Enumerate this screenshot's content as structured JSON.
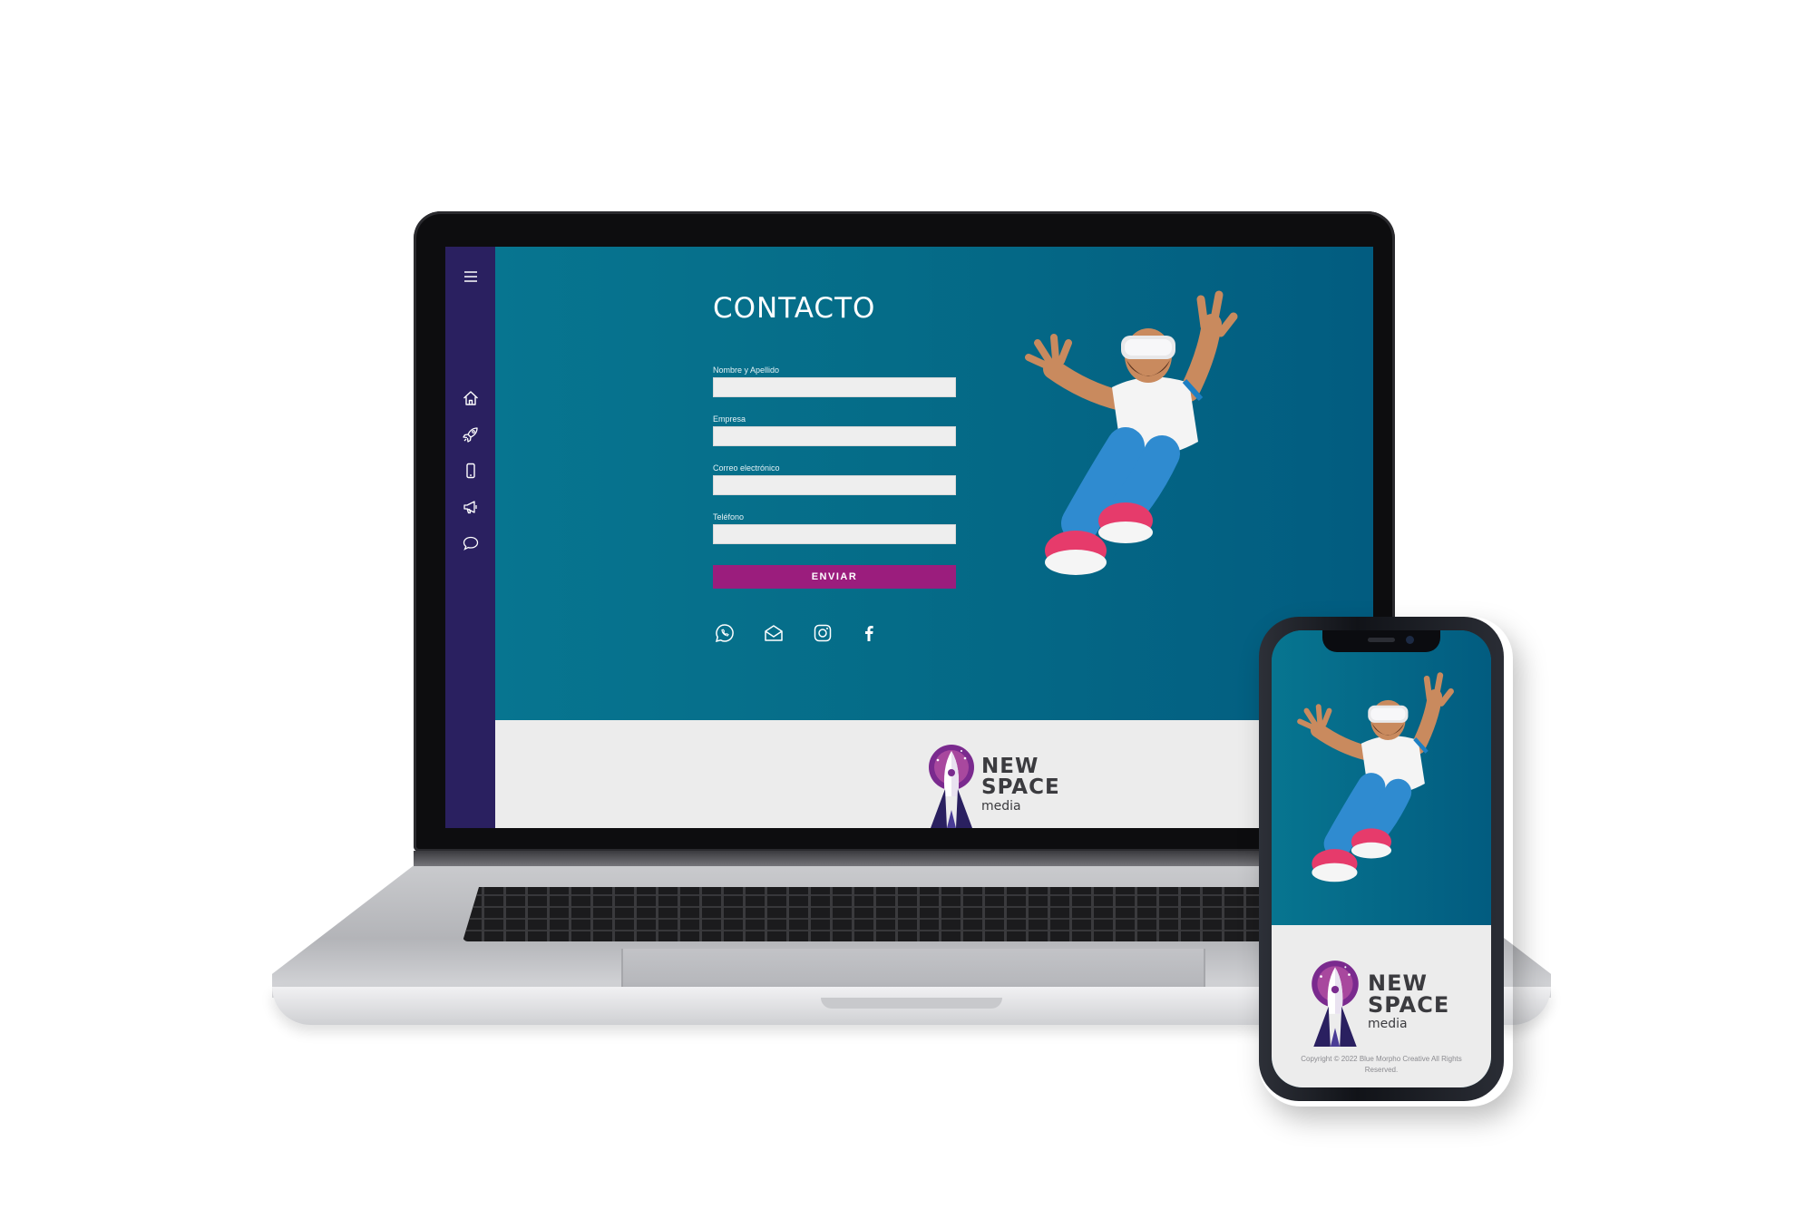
{
  "site": {
    "title": "CONTACTO",
    "nav": {
      "menu_icon": "hamburger-icon",
      "items": [
        {
          "name": "home",
          "icon": "home-icon"
        },
        {
          "name": "services",
          "icon": "rocket-icon"
        },
        {
          "name": "mobile",
          "icon": "smartphone-icon"
        },
        {
          "name": "marketing",
          "icon": "megaphone-icon"
        },
        {
          "name": "contact",
          "icon": "chat-bubble-icon"
        }
      ]
    },
    "form": {
      "fields": [
        {
          "label": "Nombre y Apellido",
          "value": ""
        },
        {
          "label": "Empresa",
          "value": ""
        },
        {
          "label": "Correo electrónico",
          "value": ""
        },
        {
          "label": "Teléfono",
          "value": ""
        }
      ],
      "submit_label": "ENVIAR"
    },
    "social": [
      {
        "name": "whatsapp",
        "icon": "whatsapp-icon"
      },
      {
        "name": "email",
        "icon": "envelope-icon"
      },
      {
        "name": "instagram",
        "icon": "instagram-icon"
      },
      {
        "name": "facebook",
        "icon": "facebook-icon"
      }
    ],
    "logo": {
      "line1": "NEW",
      "line2": "SPACE",
      "line3": "media"
    },
    "copyright": "Copyright © 2022 Blue Morpho Creative All Rights Reserved."
  },
  "colors": {
    "hero_teal": "#05708a",
    "sidebar_navy": "#2a2060",
    "accent_magenta": "#9b1d7d",
    "footer_gray": "#ececec",
    "logo_purple": "#7a2a8e"
  }
}
